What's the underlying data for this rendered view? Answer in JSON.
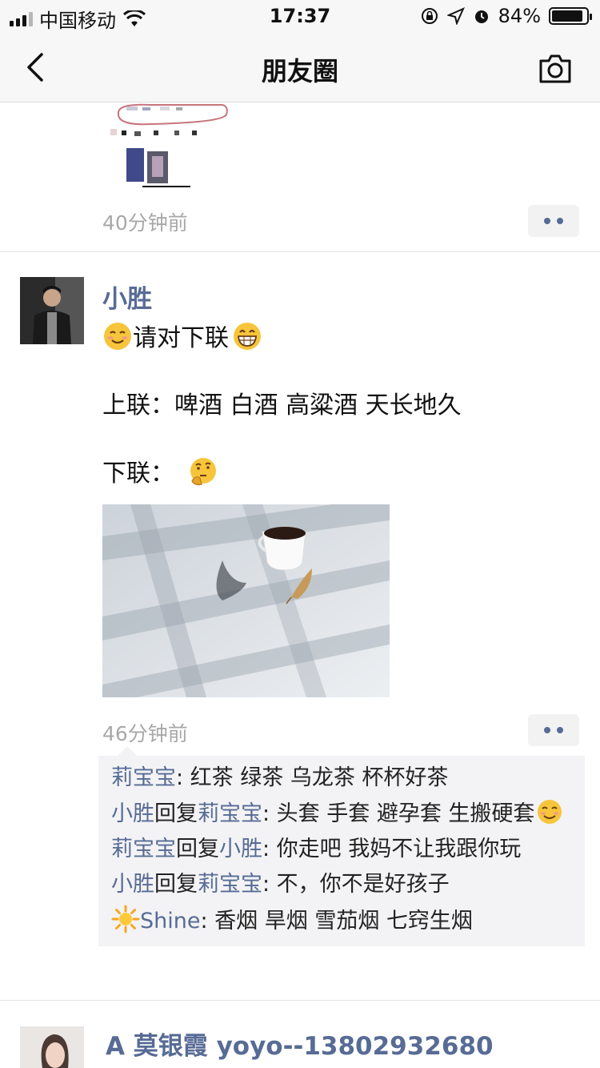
{
  "status_bar": {
    "carrier": "中国移动",
    "time": "17:37",
    "battery_percent": "84%",
    "battery_level": 0.84
  },
  "nav": {
    "title": "朋友圈",
    "back_icon": "chevron-left-icon",
    "camera_icon": "camera-icon"
  },
  "posts": [
    {
      "time": "40分钟前"
    },
    {
      "author": "小胜",
      "line1_text": "请对下联",
      "line2": "上联：啤酒 白酒 高粱酒 天长地久",
      "line3": "下联：",
      "time": "46分钟前",
      "comments": [
        {
          "user": "莉宝宝",
          "text": ": 红茶 绿茶 乌龙茶 杯杯好茶"
        },
        {
          "user": "小胜",
          "reply_word": "回复",
          "reply_to": "莉宝宝",
          "text": ": 头套 手套 避孕套 生搬硬套"
        },
        {
          "user": "莉宝宝",
          "reply_word": "回复",
          "reply_to": "小胜",
          "text": ": 你走吧 我妈不让我跟你玩"
        },
        {
          "user": "小胜",
          "reply_word": "回复",
          "reply_to": "莉宝宝",
          "text": ": 不，你不是好孩子"
        },
        {
          "user": "Shine",
          "text": ": 香烟 旱烟 雪茄烟 七窍生烟"
        }
      ]
    },
    {
      "author": "A 莫银霞 yoyo--13802932680"
    }
  ],
  "colors": {
    "link_blue": "#576b95",
    "time_gray": "#a8a8a8",
    "comment_bg": "#f3f3f5"
  }
}
